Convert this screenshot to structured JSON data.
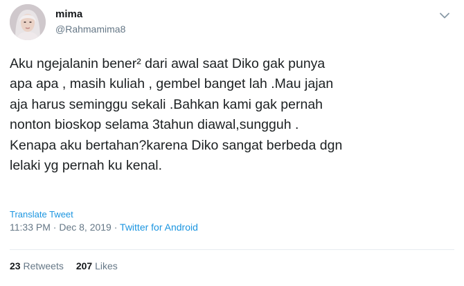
{
  "user": {
    "display_name": "mima",
    "handle": "@Rahmamima8",
    "avatar_icon": "profile-photo"
  },
  "tweet": {
    "lines": [
      "Aku ngejalanin bener² dari awal saat Diko gak punya",
      "apa apa , masih kuliah , gembel banget lah .Mau jajan",
      "aja harus seminggu sekali .Bahkan kami gak pernah",
      "nonton bioskop selama 3tahun diawal,sungguh .",
      "Kenapa aku bertahan?karena Diko sangat berbeda dgn",
      "lelaki yg pernah ku kenal."
    ],
    "translate_label": "Translate Tweet",
    "time": "11:33 PM",
    "separator": " · ",
    "date": "Dec 8, 2019",
    "source": "Twitter for Android"
  },
  "stats": {
    "retweets_count": "23",
    "retweets_label": "Retweets",
    "likes_count": "207",
    "likes_label": "Likes"
  },
  "colors": {
    "link": "#1b95e0",
    "muted": "#657786",
    "text": "#1c2022",
    "divider": "#e6ecf0"
  }
}
